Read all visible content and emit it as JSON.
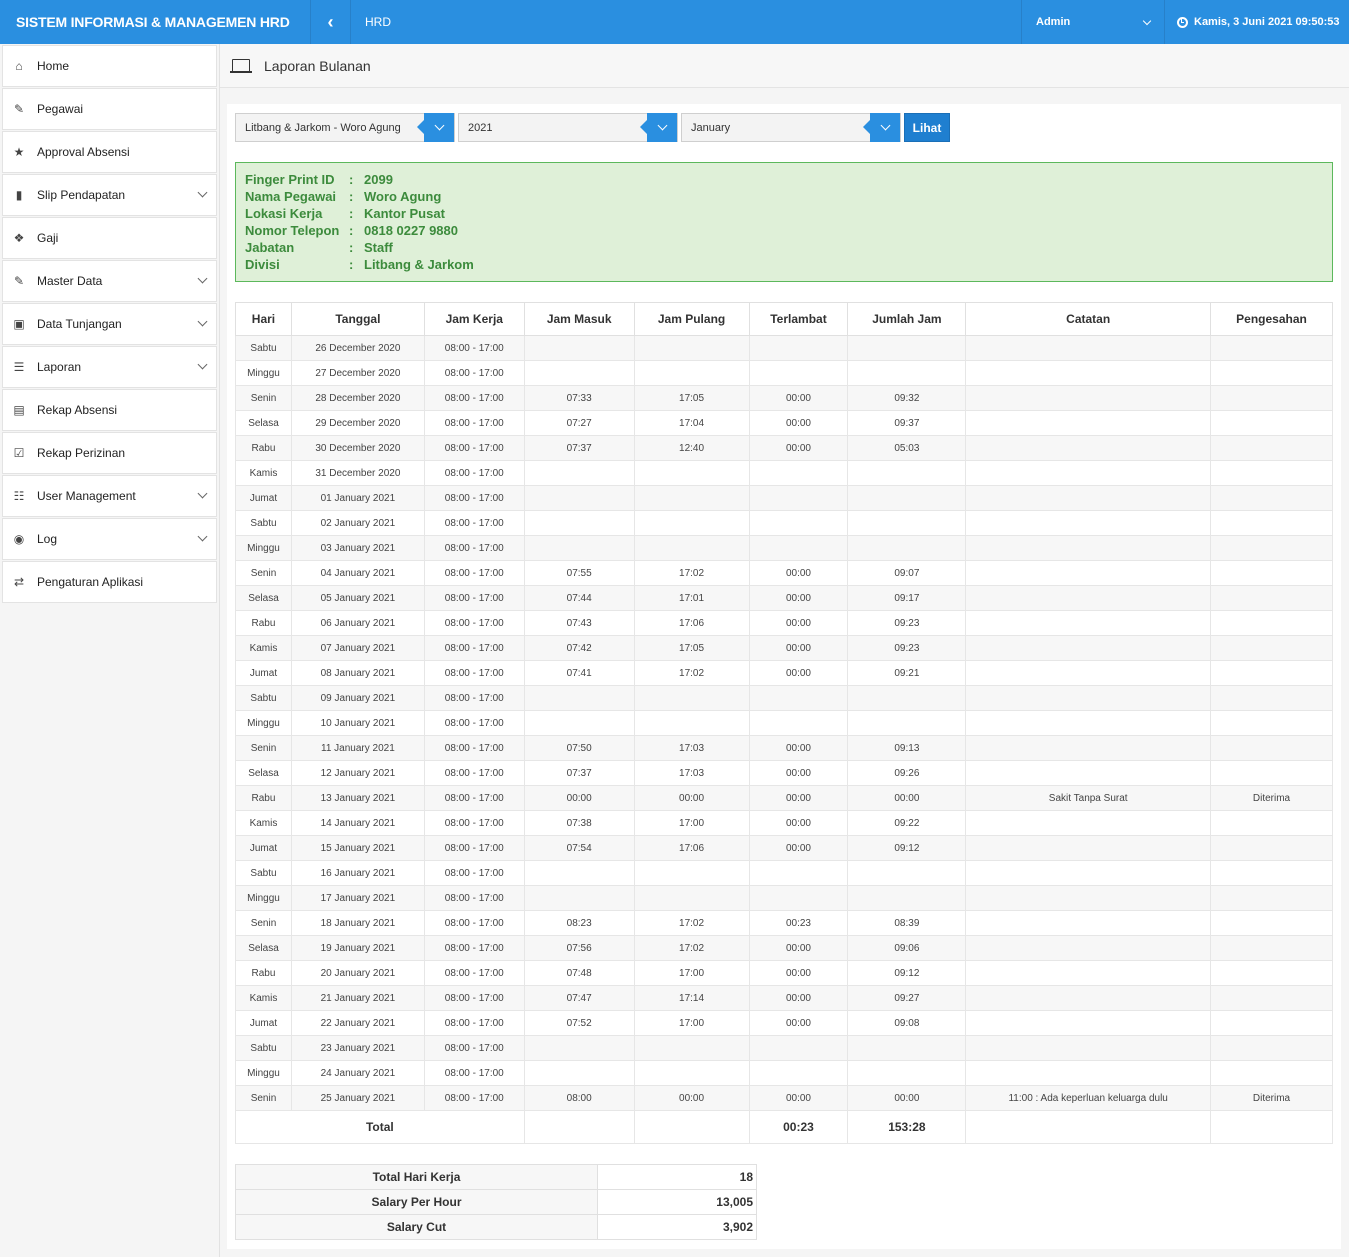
{
  "header": {
    "app_title": "SISTEM INFORMASI & MANAGEMEN HRD",
    "module": "HRD",
    "user": "Admin",
    "datetime": "Kamis, 3 Juni 2021 09:50:53"
  },
  "sidebar": {
    "items": [
      {
        "label": "Home",
        "icon": "home-icon",
        "has_submenu": false
      },
      {
        "label": "Pegawai",
        "icon": "pen-icon",
        "has_submenu": false
      },
      {
        "label": "Approval Absensi",
        "icon": "star-icon",
        "has_submenu": false
      },
      {
        "label": "Slip Pendapatan",
        "icon": "file-icon",
        "has_submenu": true
      },
      {
        "label": "Gaji",
        "icon": "gift-icon",
        "has_submenu": false
      },
      {
        "label": "Master Data",
        "icon": "pen-icon",
        "has_submenu": true
      },
      {
        "label": "Data Tunjangan",
        "icon": "money-icon",
        "has_submenu": true
      },
      {
        "label": "Laporan",
        "icon": "list-icon",
        "has_submenu": true
      },
      {
        "label": "Rekap Absensi",
        "icon": "book-icon",
        "has_submenu": false
      },
      {
        "label": "Rekap Perizinan",
        "icon": "checkbox-icon",
        "has_submenu": false
      },
      {
        "label": "User Management",
        "icon": "sitemap-icon",
        "has_submenu": true
      },
      {
        "label": "Log",
        "icon": "eye-icon",
        "has_submenu": true
      },
      {
        "label": "Pengaturan Aplikasi",
        "icon": "shuffle-icon",
        "has_submenu": false
      }
    ]
  },
  "page": {
    "title": "Laporan Bulanan"
  },
  "filters": {
    "employee": "Litbang & Jarkom - Woro Agung",
    "year": "2021",
    "month": "January",
    "submit_label": "Lihat"
  },
  "info": [
    {
      "label": "Finger Print ID",
      "value": "2099"
    },
    {
      "label": "Nama Pegawai",
      "value": "Woro Agung"
    },
    {
      "label": "Lokasi Kerja",
      "value": "Kantor Pusat"
    },
    {
      "label": "Nomor Telepon",
      "value": "0818 0227 9880"
    },
    {
      "label": "Jabatan",
      "value": "Staff"
    },
    {
      "label": "Divisi",
      "value": "Litbang & Jarkom"
    }
  ],
  "info_separator": ":",
  "table": {
    "columns": [
      "Hari",
      "Tanggal",
      "Jam Kerja",
      "Jam Masuk",
      "Jam Pulang",
      "Terlambat",
      "Jumlah Jam",
      "Catatan",
      "Pengesahan"
    ],
    "rows": [
      [
        "Sabtu",
        "26 December 2020",
        "08:00 - 17:00",
        "",
        "",
        "",
        "",
        "",
        ""
      ],
      [
        "Minggu",
        "27 December 2020",
        "08:00 - 17:00",
        "",
        "",
        "",
        "",
        "",
        ""
      ],
      [
        "Senin",
        "28 December 2020",
        "08:00 - 17:00",
        "07:33",
        "17:05",
        "00:00",
        "09:32",
        "",
        ""
      ],
      [
        "Selasa",
        "29 December 2020",
        "08:00 - 17:00",
        "07:27",
        "17:04",
        "00:00",
        "09:37",
        "",
        ""
      ],
      [
        "Rabu",
        "30 December 2020",
        "08:00 - 17:00",
        "07:37",
        "12:40",
        "00:00",
        "05:03",
        "",
        ""
      ],
      [
        "Kamis",
        "31 December 2020",
        "08:00 - 17:00",
        "",
        "",
        "",
        "",
        "",
        ""
      ],
      [
        "Jumat",
        "01 January 2021",
        "08:00 - 17:00",
        "",
        "",
        "",
        "",
        "",
        ""
      ],
      [
        "Sabtu",
        "02 January 2021",
        "08:00 - 17:00",
        "",
        "",
        "",
        "",
        "",
        ""
      ],
      [
        "Minggu",
        "03 January 2021",
        "08:00 - 17:00",
        "",
        "",
        "",
        "",
        "",
        ""
      ],
      [
        "Senin",
        "04 January 2021",
        "08:00 - 17:00",
        "07:55",
        "17:02",
        "00:00",
        "09:07",
        "",
        ""
      ],
      [
        "Selasa",
        "05 January 2021",
        "08:00 - 17:00",
        "07:44",
        "17:01",
        "00:00",
        "09:17",
        "",
        ""
      ],
      [
        "Rabu",
        "06 January 2021",
        "08:00 - 17:00",
        "07:43",
        "17:06",
        "00:00",
        "09:23",
        "",
        ""
      ],
      [
        "Kamis",
        "07 January 2021",
        "08:00 - 17:00",
        "07:42",
        "17:05",
        "00:00",
        "09:23",
        "",
        ""
      ],
      [
        "Jumat",
        "08 January 2021",
        "08:00 - 17:00",
        "07:41",
        "17:02",
        "00:00",
        "09:21",
        "",
        ""
      ],
      [
        "Sabtu",
        "09 January 2021",
        "08:00 - 17:00",
        "",
        "",
        "",
        "",
        "",
        ""
      ],
      [
        "Minggu",
        "10 January 2021",
        "08:00 - 17:00",
        "",
        "",
        "",
        "",
        "",
        ""
      ],
      [
        "Senin",
        "11 January 2021",
        "08:00 - 17:00",
        "07:50",
        "17:03",
        "00:00",
        "09:13",
        "",
        ""
      ],
      [
        "Selasa",
        "12 January 2021",
        "08:00 - 17:00",
        "07:37",
        "17:03",
        "00:00",
        "09:26",
        "",
        ""
      ],
      [
        "Rabu",
        "13 January 2021",
        "08:00 - 17:00",
        "00:00",
        "00:00",
        "00:00",
        "00:00",
        "Sakit Tanpa Surat",
        "Diterima"
      ],
      [
        "Kamis",
        "14 January 2021",
        "08:00 - 17:00",
        "07:38",
        "17:00",
        "00:00",
        "09:22",
        "",
        ""
      ],
      [
        "Jumat",
        "15 January 2021",
        "08:00 - 17:00",
        "07:54",
        "17:06",
        "00:00",
        "09:12",
        "",
        ""
      ],
      [
        "Sabtu",
        "16 January 2021",
        "08:00 - 17:00",
        "",
        "",
        "",
        "",
        "",
        ""
      ],
      [
        "Minggu",
        "17 January 2021",
        "08:00 - 17:00",
        "",
        "",
        "",
        "",
        "",
        ""
      ],
      [
        "Senin",
        "18 January 2021",
        "08:00 - 17:00",
        "08:23",
        "17:02",
        "00:23",
        "08:39",
        "",
        ""
      ],
      [
        "Selasa",
        "19 January 2021",
        "08:00 - 17:00",
        "07:56",
        "17:02",
        "00:00",
        "09:06",
        "",
        ""
      ],
      [
        "Rabu",
        "20 January 2021",
        "08:00 - 17:00",
        "07:48",
        "17:00",
        "00:00",
        "09:12",
        "",
        ""
      ],
      [
        "Kamis",
        "21 January 2021",
        "08:00 - 17:00",
        "07:47",
        "17:14",
        "00:00",
        "09:27",
        "",
        ""
      ],
      [
        "Jumat",
        "22 January 2021",
        "08:00 - 17:00",
        "07:52",
        "17:00",
        "00:00",
        "09:08",
        "",
        ""
      ],
      [
        "Sabtu",
        "23 January 2021",
        "08:00 - 17:00",
        "",
        "",
        "",
        "",
        "",
        ""
      ],
      [
        "Minggu",
        "24 January 2021",
        "08:00 - 17:00",
        "",
        "",
        "",
        "",
        "",
        ""
      ],
      [
        "Senin",
        "25 January 2021",
        "08:00 - 17:00",
        "08:00",
        "00:00",
        "00:00",
        "00:00",
        "11:00 : Ada keperluan keluarga dulu",
        "Diterima"
      ]
    ],
    "total_label": "Total",
    "total_terlambat": "00:23",
    "total_jumlah_jam": "153:28"
  },
  "summary": [
    {
      "label": "Total Hari Kerja",
      "value": "18"
    },
    {
      "label": "Salary Per Hour",
      "value": "13,005"
    },
    {
      "label": "Salary Cut",
      "value": "3,902"
    }
  ],
  "colors": {
    "primary": "#2a8fe0",
    "info_bg": "#dff0d8",
    "info_text": "#3c8b3c"
  }
}
